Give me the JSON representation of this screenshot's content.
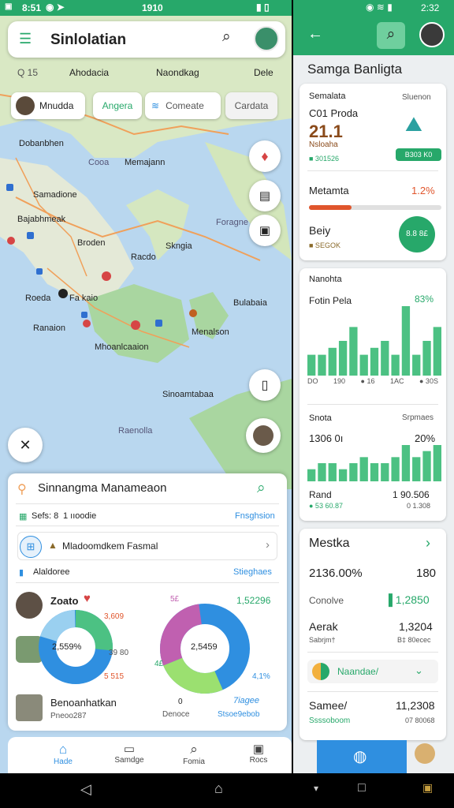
{
  "left_status": {
    "time": "8:51",
    "center": "1910"
  },
  "search": {
    "title": "Sinlolatian"
  },
  "map_header": {
    "left": "Q 15",
    "mid": "Ahodacia",
    "right": "Naondkag",
    "far": "Dele"
  },
  "chips": [
    {
      "label": "Mnudda"
    },
    {
      "label": "Angera"
    },
    {
      "label": "Comeate"
    },
    {
      "label": "Cardata"
    }
  ],
  "map_labels": {
    "l1": "Dobanbhen",
    "l2": "Cooa",
    "l3": "Memajann",
    "l4": "Samadione",
    "l5": "Bajabhmeak",
    "l6": "Broden",
    "l7": "Skngia",
    "l8": "Foragne",
    "l9": "Racdo",
    "l10": "Roeda",
    "l11": "Fa kaio",
    "l12": "Ranaion",
    "l13": "Menalson",
    "l14": "Mhoanlcaaion",
    "l15": "Bulabaia",
    "l16": "Sinoamtabaa",
    "l17": "Raenolla"
  },
  "sheet": {
    "title": "Sinnangma Manameaon",
    "row1_left": "Sefs: 8",
    "row1_mid": "1 ııoodie",
    "row1_right": "Fnsghsion",
    "row2": "Mladoomdkem Fasmal",
    "row3_left": "Alaldoree",
    "row3_right": "Stieghaes",
    "donut1": {
      "name": "Zoato",
      "label_tr": "3,609",
      "center": "2,559%",
      "label_r": "39 80",
      "label_br": "5 515"
    },
    "donut2": {
      "label_tl": "5£",
      "label_tr": "1,52296",
      "center": "2,5459",
      "label_l": "4£",
      "label_br": "4,1%"
    },
    "footer_title": "Benoanhatkan",
    "footer_sub": "Pneoo287",
    "footer_mid_num": "0",
    "footer_mid": "Denoce",
    "footer_right_title": "7iagee",
    "footer_right": "Stsoe9ebob"
  },
  "bottom_nav": [
    "Hade",
    "Samdge",
    "Fomia",
    "Rocs"
  ],
  "right_status": {
    "time": "2:32"
  },
  "rheader": {
    "title": "Samga Banligta"
  },
  "card1": {
    "label": "Semalata",
    "label_r": "Sluenon",
    "sub": "C01 Proda",
    "big": "21.1",
    "sub2": "Nsloaha",
    "meta": "■ 301526",
    "badge": "B303 K0",
    "row2_label": "Metamta",
    "row2_r": "1.2%",
    "row3_label": "Beiy",
    "row3_sub": "■ SEGOK",
    "row3_circle": "8.8 8£"
  },
  "card2": {
    "title": "Nanohta",
    "sub": "Fotin Pela",
    "pct": "83%",
    "axis": [
      "DO",
      "190",
      "● 16",
      "1AC",
      "● 30S"
    ],
    "s2_label": "Snota",
    "s2_r": "Srpmaes",
    "s2_value": "1306 0ı",
    "s2_pct": "20%",
    "s2_foot_l": "Rand",
    "s2_foot_r": "1 90.506",
    "s2_foot_l2": "● 53 60.87",
    "s2_foot_r2": "0 1.308"
  },
  "card3": {
    "title": "Mestka",
    "v1": "2136.00%",
    "v1r": "180",
    "r2l": "Conolve",
    "r2r": "▐ 1,2850",
    "r3l": "Aerak",
    "r3r": "1,3204",
    "r3l2": "Sabrjm†",
    "r3r2": "B‡ 80ecec",
    "r4l": "Naandae/",
    "r5l": "Samee/",
    "r5r": "11,2308",
    "r5l2": "Ssssoboom",
    "r5r2": "07 80068"
  },
  "colors": {
    "green": "#27a86a",
    "bar": "#4cc183",
    "orange": "#e0552c",
    "yellow": "#f2b03e",
    "blue": "#2f8fe0"
  },
  "chart_data": [
    {
      "type": "bar",
      "title": "",
      "values": [
        3,
        3,
        4,
        5,
        7,
        3,
        4,
        5,
        3,
        10,
        3,
        5,
        7
      ]
    },
    {
      "type": "bar",
      "title": "",
      "values": [
        2,
        3,
        3,
        2,
        3,
        4,
        3,
        3,
        4,
        6,
        4,
        5,
        6
      ]
    }
  ]
}
